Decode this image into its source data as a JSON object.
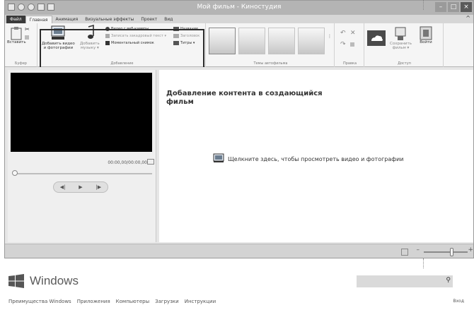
{
  "window": {
    "title": "Мой фильм - Киностудия",
    "controls": {
      "minimize": "–",
      "maximize": "□",
      "close": "×"
    }
  },
  "ribbon_tabs": [
    {
      "label": "Файл"
    },
    {
      "label": "Главная"
    },
    {
      "label": "Анимация"
    },
    {
      "label": "Визуальные эффекты"
    },
    {
      "label": "Проект"
    },
    {
      "label": "Вид"
    }
  ],
  "ribbon_help": "^",
  "ribbon": {
    "clipboard": {
      "paste": "Вставить",
      "group": "Буфер"
    },
    "add": {
      "add_video": "Добавить видео\nи фотографии",
      "add_music": "Добавить\nмузыку ▾",
      "webcam": "Видео с веб-камеры",
      "narration": "Записать закадровый текст ▾",
      "snapshot": "Моментальный снимок",
      "title": "Название",
      "caption": "Заголовок",
      "credits": "Титры ▾",
      "group": "Добавление"
    },
    "themes": {
      "group": "Темы автофильма"
    },
    "edit": {
      "group": "Правка"
    },
    "share": {
      "save_movie": "Сохранить\nфильм ▾",
      "sign_in": "Войти",
      "group": "Доступ"
    }
  },
  "preview": {
    "timecode": "00:00,00/00:00,00"
  },
  "storyboard": {
    "heading": "Добавление контента в создающийся фильм",
    "hint": "Щелкните здесь, чтобы просмотреть видео и фотографии"
  },
  "zoom": {
    "minus": "–",
    "plus": "+"
  },
  "site": {
    "logo_text": "Windows",
    "nav": [
      "Преимущества Windows",
      "Приложения",
      "Компьютеры",
      "Загрузки",
      "Инструкции"
    ],
    "login": "Вход"
  },
  "icons": {
    "paste": "clipboard-paste-icon",
    "add_video": "film-photo-icon",
    "add_music": "music-note-icon",
    "webcam": "webcam-icon",
    "narration": "microphone-icon",
    "snapshot": "camera-snapshot-icon",
    "title": "title-icon",
    "caption": "caption-icon",
    "credits": "credits-icon",
    "rotate_left": "rotate-left-icon",
    "remove": "remove-x-icon",
    "onedrive": "cloud-icon",
    "save_movie": "save-movie-icon",
    "sign_in": "sign-in-icon",
    "search": "magnifier-icon"
  }
}
